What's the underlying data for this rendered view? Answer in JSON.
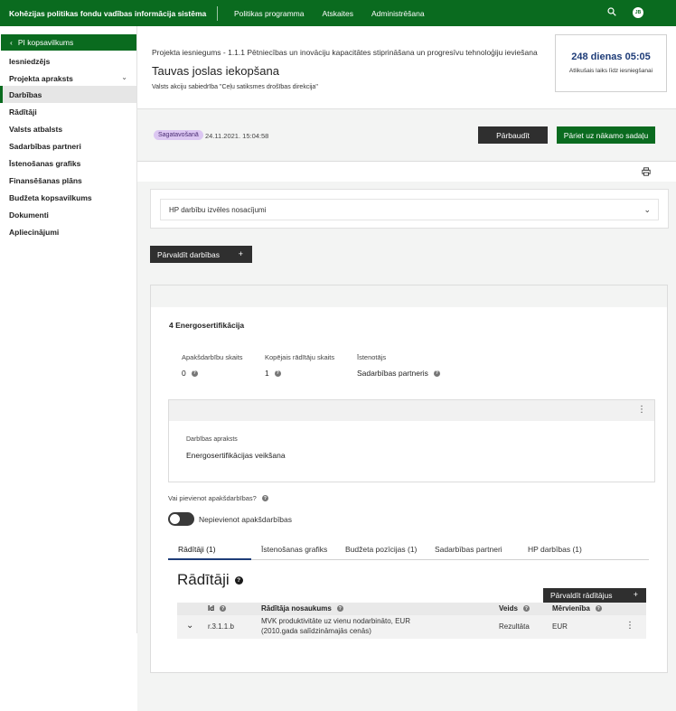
{
  "app": {
    "title": "Kohēzijas politikas fondu vadības informācija sistēma",
    "nav": [
      "Politikas programma",
      "Atskaites",
      "Administrēšana"
    ],
    "user_initials": "JB"
  },
  "sidebar": {
    "summary_label": "PI kopsavilkums",
    "items": [
      {
        "label": "Iesniedzējs"
      },
      {
        "label": "Projekta apraksts"
      },
      {
        "label": "Darbības"
      },
      {
        "label": "Rādītāji"
      },
      {
        "label": "Valsts atbalsts"
      },
      {
        "label": "Sadarbības partneri"
      },
      {
        "label": "Īstenošanas grafiks"
      },
      {
        "label": "Finansēšanas plāns"
      },
      {
        "label": "Budžeta kopsavilkums"
      },
      {
        "label": "Dokumenti"
      },
      {
        "label": "Apliecinājumi"
      }
    ]
  },
  "header": {
    "breadcrumb": "Projekta iesniegums - 1.1.1 Pētniecības un inovāciju kapacitātes stiprināšana un progresīvu tehnoloģiju ieviešana",
    "title": "Tauvas joslas iekopšana",
    "organization": "Valsts akciju sabiedrība \"Ceļu satiksmes drošības direkcija\"",
    "deadline_value": "248 dienas 05:05",
    "deadline_label": "Atlikušais laiks līdz iesniegšanai"
  },
  "status": {
    "badge": "Sagatavošanā",
    "date": "24.11.2021. 15:04:58",
    "check_button": "Pārbaudīt",
    "next_button": "Pāriet uz nākamo sadaļu"
  },
  "accordion": {
    "label": "HP darbību izvēles nosacījumi"
  },
  "manage_activities": "Pārvaldīt darbības",
  "activity": {
    "title": "4 Energosertifikācija",
    "sub_count_label": "Apakšdarbību skaits",
    "sub_count_value": "0",
    "indicator_count_label": "Kopējais rādītāju skaits",
    "indicator_count_value": "1",
    "implementer_label": "Īstenotājs",
    "implementer_value": "Sadarbības partneris",
    "description_label": "Darbības apraksts",
    "description_value": "Energosertifikācijas veikšana",
    "add_sub_question": "Vai pievienot apakšdarbības?",
    "toggle_label": "Nepievienot apakšdarbības"
  },
  "tabs": [
    {
      "label": "Rādītāji (1)"
    },
    {
      "label": "Īstenošanas grafiks"
    },
    {
      "label": "Budžeta pozīcijas (1)"
    },
    {
      "label": "Sadarbības partneri"
    },
    {
      "label": "HP darbības (1)"
    }
  ],
  "indicators": {
    "title": "Rādītāji",
    "manage_button": "Pārvaldīt rādītājus",
    "columns": [
      "Id",
      "Rādītāja nosaukums",
      "Veids",
      "Mērvienība"
    ],
    "rows": [
      {
        "id": "r.3.1.1.b",
        "name_line1": "MVK produktivitāte uz vienu nodarbināto, EUR",
        "name_line2": "(2010.gada salīdzināmajās cenās)",
        "type": "Rezultāta",
        "unit": "EUR"
      }
    ]
  },
  "colors": {
    "brand_green": "#0a6b1f",
    "dark_button": "#2f2f2f",
    "badge_bg": "#dcc7f2",
    "deadline_blue": "#1e3c78"
  }
}
